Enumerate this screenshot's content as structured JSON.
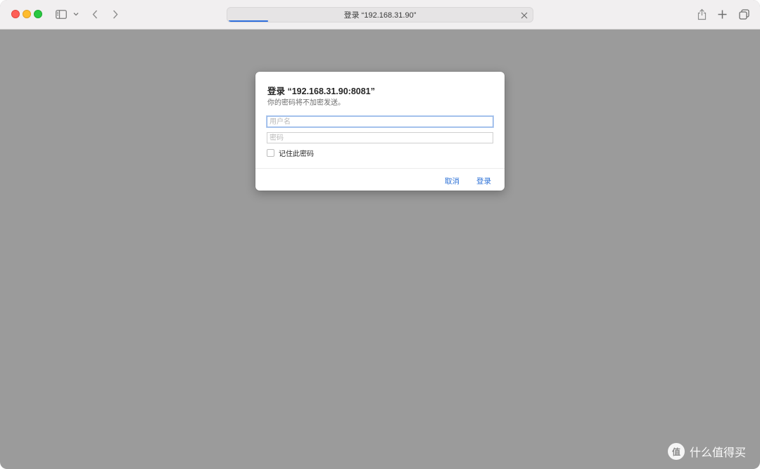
{
  "window": {
    "background_color": "#9b9b9b"
  },
  "toolbar": {
    "traffic_lights": [
      "close",
      "minimize",
      "zoom"
    ],
    "sidebar_icon": "sidebar-icon",
    "chevron_icon": "chevron-down-icon",
    "back_icon": "back-icon",
    "forward_icon": "forward-icon",
    "address_text": "登录 “192.168.31.90”",
    "loading_progress": 0.13,
    "share_icon": "share-icon",
    "new_tab_icon": "plus-icon",
    "tabs_icon": "tab-overview-icon"
  },
  "dialog": {
    "title": "登录 “192.168.31.90:8081”",
    "subtitle": "你的密码将不加密发送。",
    "username_placeholder": "用户名",
    "username_value": "",
    "password_placeholder": "密码",
    "password_value": "",
    "remember_label": "记住此密码",
    "remember_checked": false,
    "cancel_label": "取消",
    "login_label": "登录",
    "accent_color": "#2a6fd6"
  },
  "watermark": {
    "logo": "值",
    "text": "什么值得买"
  }
}
